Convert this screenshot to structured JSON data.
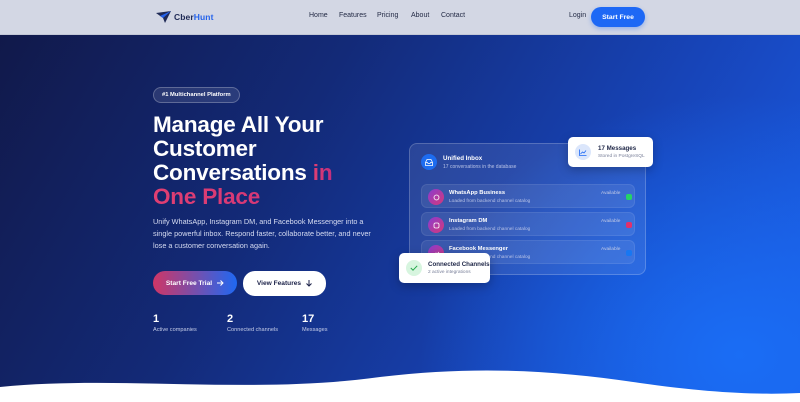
{
  "brand": {
    "name_part1": "Cber",
    "name_part2": "Hunt"
  },
  "nav": {
    "links": [
      "Home",
      "Features",
      "Pricing",
      "About",
      "Contact"
    ],
    "login": "Login",
    "cta": "Start Free"
  },
  "hero": {
    "badge": "#1 Multichannel Platform",
    "headline_lines": [
      "Manage All Your",
      "Customer",
      "Conversations"
    ],
    "headline_accent_1": "in",
    "headline_accent_2": "One Place",
    "subtitle": "Unify WhatsApp, Instagram DM, and Facebook Messenger into a single powerful inbox. Respond faster, collaborate better, and never lose a customer conversation again.",
    "primary_button": "Start Free Trial",
    "secondary_button": "View Features",
    "stats": [
      {
        "value": "1",
        "label": "Active companies"
      },
      {
        "value": "2",
        "label": "Connected channels"
      },
      {
        "value": "17",
        "label": "Messages"
      }
    ]
  },
  "inbox": {
    "title": "Unified Inbox",
    "subtitle": "17 conversations in the database",
    "channels": [
      {
        "name": "WhatsApp Business",
        "desc": "Loaded from backend channel catalog",
        "status": "Available",
        "icon": "whatsapp-icon",
        "color": "#25d366"
      },
      {
        "name": "Instagram DM",
        "desc": "Loaded from backend channel catalog",
        "status": "Available",
        "icon": "instagram-icon",
        "color": "#e1306c"
      },
      {
        "name": "Facebook Messenger",
        "desc": "Loaded from backend channel catalog",
        "status": "Available",
        "icon": "messenger-icon",
        "color": "#1877f2"
      }
    ]
  },
  "popups": {
    "messages": {
      "title": "17 Messages",
      "sub": "Stored in PostgreSQL"
    },
    "connected": {
      "title": "Connected Channels",
      "sub": "2 active integrations"
    }
  },
  "colors": {
    "accent": "#1d68f5",
    "headline_accent": "#e13f72",
    "hero_dark": "#11194a"
  }
}
